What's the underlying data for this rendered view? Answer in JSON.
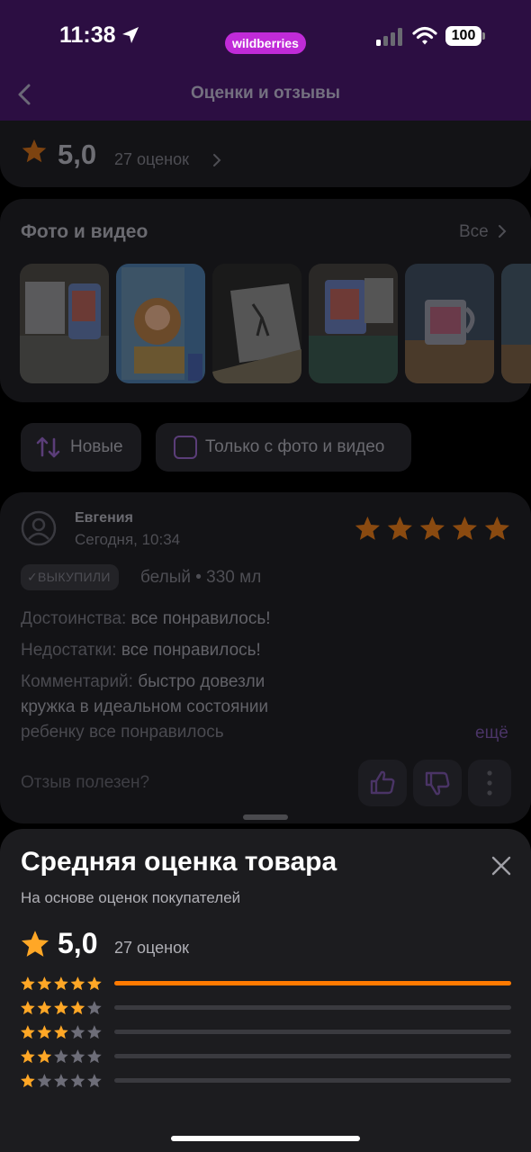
{
  "status_bar": {
    "time": "11:38",
    "brand_logo": "wildberries",
    "battery": "100"
  },
  "header": {
    "title": "Оценки и отзывы"
  },
  "rating_summary": {
    "value": "5,0",
    "count": "27 оценок"
  },
  "media": {
    "title": "Фото и видео",
    "all_label": "Все",
    "thumbnail_count": 6
  },
  "filters": {
    "sort_label": "Новые",
    "photo_only_label": "Только с фото и видео"
  },
  "review": {
    "author": "Евгения",
    "date": "Сегодня, 10:34",
    "stars": 5,
    "badge": "ВЫКУПИЛИ",
    "variant": "белый • 330 мл",
    "pros_label": "Достоинства:",
    "pros": "все понравилось!",
    "cons_label": "Недостатки:",
    "cons": "все понравилось!",
    "comment_label": "Комментарий:",
    "comment_line1": "быстро довезли",
    "comment_line2": "кружка в идеальном состоянии",
    "comment_line3": "ребенку все понравилось",
    "more": "ещё",
    "helpful_question": "Отзыв полезен?"
  },
  "sheet": {
    "title": "Средняя оценка товара",
    "subtitle": "На основе оценок покупателей",
    "value": "5,0",
    "count": "27 оценок",
    "distribution": [
      {
        "stars": 5,
        "share": 1.0
      },
      {
        "stars": 4,
        "share": 0
      },
      {
        "stars": 3,
        "share": 0
      },
      {
        "stars": 2,
        "share": 0
      },
      {
        "stars": 1,
        "share": 0
      }
    ]
  },
  "colors": {
    "accent_orange": "#ff7a00",
    "brand_purple": "#c02bd8",
    "header_purple": "#2c0e42",
    "sheet_bg": "#1c1c1f",
    "inactive_star": "#6d6d78"
  }
}
